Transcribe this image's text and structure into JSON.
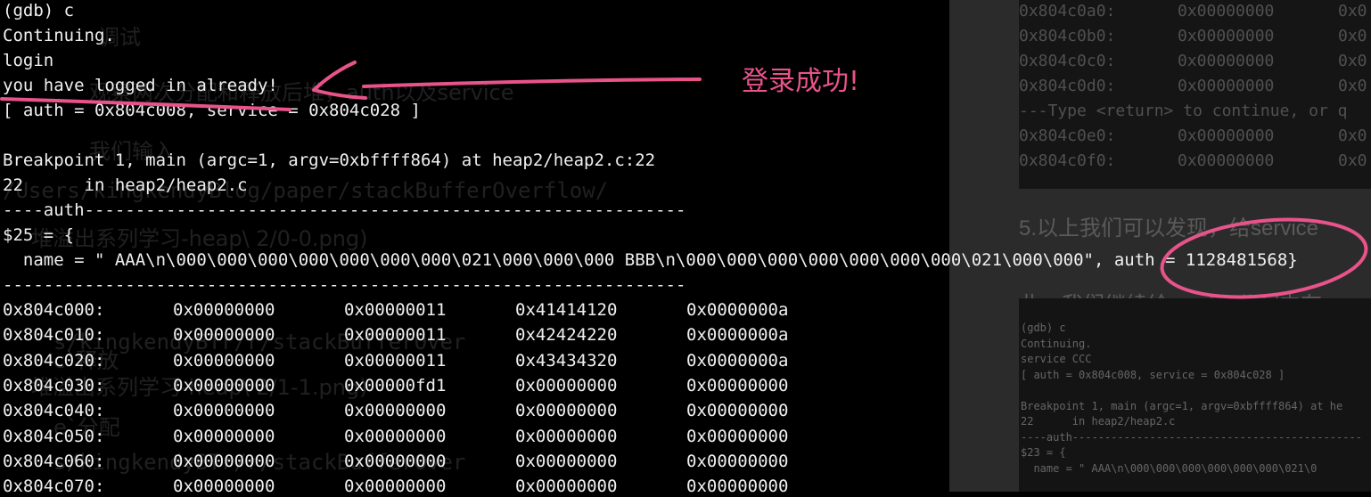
{
  "background_page": {
    "mini_terminal_top": [
      {
        "addr": "0x804c0a0:",
        "v1": "0x00000000",
        "v2": "0x0"
      },
      {
        "addr": "0x804c0b0:",
        "v1": "0x00000000",
        "v2": "0x0"
      },
      {
        "addr": "0x804c0c0:",
        "v1": "0x00000000",
        "v2": "0x0"
      },
      {
        "addr": "0x804c0d0:",
        "v1": "0x00000000",
        "v2": "0x0"
      },
      {
        "addr": "---Type <return> to continue, or q",
        "v1": "",
        "v2": ""
      },
      {
        "addr": "0x804c0e0:",
        "v1": "0x00000000",
        "v2": "0x0"
      },
      {
        "addr": "0x804c0f0:",
        "v1": "0x00000000",
        "v2": "0x0"
      }
    ],
    "blog_line1": "5.以上我们可以发现，给service",
    "blog_line2": "此，我们继续给service分配内存",
    "mini_terminal_bottom": [
      "(gdb) c",
      "Continuing.",
      "service CCC",
      "[ auth = 0x804c008, service = 0x804c028 ]",
      "",
      "Breakpoint 1, main (argc=1, argv=0xbffff864) at he",
      "22      in heap2/heap2.c",
      "----auth---------------------------------------------",
      "$23 = {",
      "  name = \" AAA\\n\\000\\000\\000\\000\\000\\000\\021\\0"
    ],
    "ghost_lines": [
      {
        "text": "调试",
        "cjk": true
      },
      {
        "text": "观察两次分配和释放后堆，auth以及service",
        "cjk": true
      },
      {
        "text": "我们输入",
        "cjk": true
      },
      {
        "text": "/Users/kingkendyBlog/paper/stackBufferOverflow/",
        "cjk": false
      },
      {
        "text": "堆溢出系列学习-heap\\ 2/0-0.png)",
        "cjk": true
      },
      {
        "text": "c`释放",
        "cjk": true
      },
      {
        "text": "s/kingkendyBTr/r/stackBufferOver",
        "cjk": false
      },
      {
        "text": "堆溢出系列学习-heap\\ 2/1-1.png)",
        "cjk": true
      },
      {
        "text": "e`分配",
        "cjk": true
      },
      {
        "text": "s/kingkendyBTr/r/stackBufferOver",
        "cjk": false
      }
    ]
  },
  "terminal": {
    "lines": [
      "(gdb) c",
      "Continuing.",
      "login",
      "you have logged in already!",
      "[ auth = 0x804c008, service = 0x804c028 ]",
      "",
      "Breakpoint 1, main (argc=1, argv=0xbffff864) at heap2/heap2.c:22",
      "22      in heap2/heap2.c",
      "----auth-----------------------------------------------------------",
      "$25 = {",
      "  name = \" AAA\\n\\000\\000\\000\\000\\000\\000\\000\\021\\000\\000\\000 BBB\\n\\000\\000\\000\\000\\000\\000\\000\\021\\000\\000\", auth = 1128481568}",
      "-------------------------------------------------------------------"
    ],
    "memory_rows": [
      [
        "0x804c000:",
        "0x00000000",
        "0x00000011",
        "0x41414120",
        "0x0000000a"
      ],
      [
        "0x804c010:",
        "0x00000000",
        "0x00000011",
        "0x42424220",
        "0x0000000a"
      ],
      [
        "0x804c020:",
        "0x00000000",
        "0x00000011",
        "0x43434320",
        "0x0000000a"
      ],
      [
        "0x804c030:",
        "0x00000000",
        "0x00000fd1",
        "0x00000000",
        "0x00000000"
      ],
      [
        "0x804c040:",
        "0x00000000",
        "0x00000000",
        "0x00000000",
        "0x00000000"
      ],
      [
        "0x804c050:",
        "0x00000000",
        "0x00000000",
        "0x00000000",
        "0x00000000"
      ],
      [
        "0x804c060:",
        "0x00000000",
        "0x00000000",
        "0x00000000",
        "0x00000000"
      ],
      [
        "0x804c070:",
        "0x00000000",
        "0x00000000",
        "0x00000000",
        "0x00000000"
      ]
    ]
  },
  "annotation": {
    "text": "登录成功!",
    "color": "#e8538a"
  }
}
